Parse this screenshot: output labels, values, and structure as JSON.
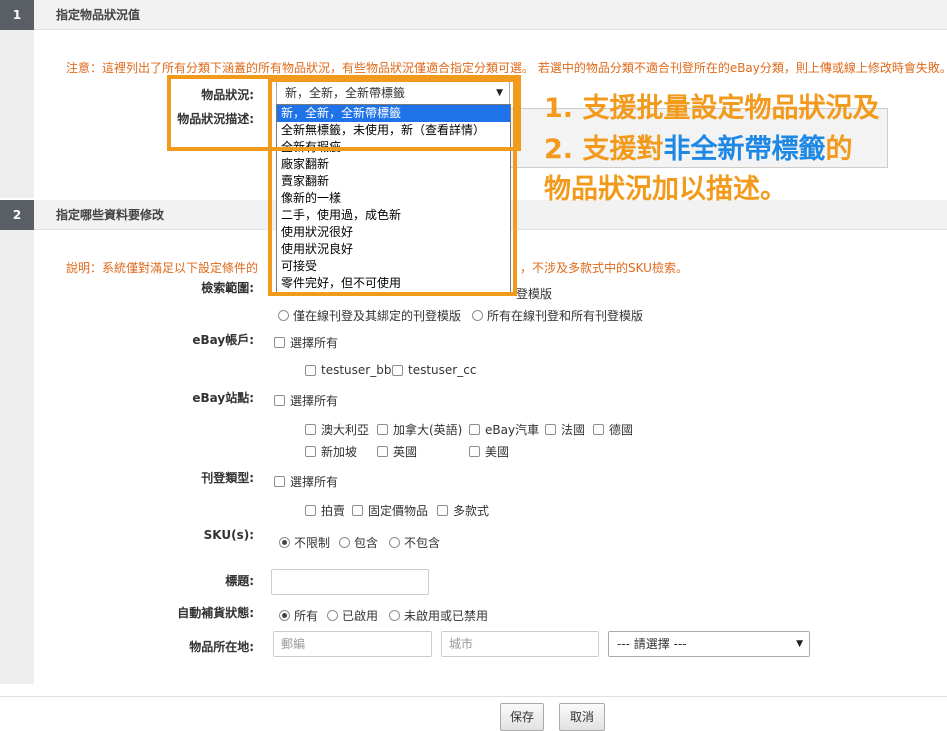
{
  "section1": {
    "number": "1",
    "title": "指定物品狀況值",
    "notice": "注意：這裡列出了所有分類下涵蓋的所有物品狀況，有些物品狀況僅適合指定分類可選。 若選中的物品分類不適合刊登所在的eBay分類，則上傳或線上修改時會失敗。",
    "condition_label": "物品狀況:",
    "condition_value": "新，全新，全新帶標籤",
    "description_label": "物品狀況描述:",
    "dropdown_options": [
      "新，全新，全新帶標籤",
      "全新無標籤，未使用，新（查看詳情）",
      "全新有瑕疵",
      "廠家翻新",
      "賣家翻新",
      "像新的一樣",
      "二手，使用過，成色新",
      "使用狀況很好",
      "使用狀況良好",
      "可接受",
      "零件完好，但不可使用"
    ]
  },
  "annotation": {
    "line1": "1. 支援批量設定物品狀況及",
    "line2_prefix": "2. 支援對",
    "line2_highlight": "非全新帶標籤",
    "line2_suffix": "的",
    "line3": "物品狀況加以描述。"
  },
  "section2": {
    "number": "2",
    "title": "指定哪些資料要修改",
    "notice_left": "說明：系統僅對滿足以下設定條件的",
    "notice_right": "，不涉及多款式中的SKU檢索。",
    "scope": {
      "label": "檢索範圍:",
      "option1_tail": "登模版",
      "option2": "僅在線刊登及其綁定的刊登模版",
      "option3": "所有在線刊登和所有刊登模版"
    },
    "accounts": {
      "label": "eBay帳戶:",
      "select_all": "選擇所有",
      "items": [
        "testuser_bb",
        "testuser_cc"
      ]
    },
    "sites": {
      "label": "eBay站點:",
      "select_all": "選擇所有",
      "row1": [
        "澳大利亞",
        "加拿大(英語)",
        "eBay汽車",
        "法國",
        "德國"
      ],
      "row2": [
        "新加坡",
        "英國",
        "美國"
      ]
    },
    "listing_type": {
      "label": "刊登類型:",
      "select_all": "選擇所有",
      "items": [
        "拍賣",
        "固定價物品",
        "多款式"
      ]
    },
    "sku": {
      "label": "SKU(s):",
      "options": [
        "不限制",
        "包含",
        "不包含"
      ]
    },
    "title_field": {
      "label": "標題:",
      "value": ""
    },
    "restock": {
      "label": "自動補貨狀態:",
      "options": [
        "所有",
        "已啟用",
        "未啟用或已禁用"
      ]
    },
    "location": {
      "label": "物品所在地:",
      "postcode_placeholder": "郵編",
      "city_placeholder": "城市",
      "select_value": "--- 請選擇 ---"
    }
  },
  "footer": {
    "save": "保存",
    "cancel": "取消"
  },
  "colors": {
    "highlight_orange": "#f29a1c",
    "highlight_blue": "#1e88e5",
    "notice_orange": "#e06a1b",
    "selected_option": "#1e73e8"
  },
  "icons": {
    "dropdown_caret": "triangle-down"
  }
}
